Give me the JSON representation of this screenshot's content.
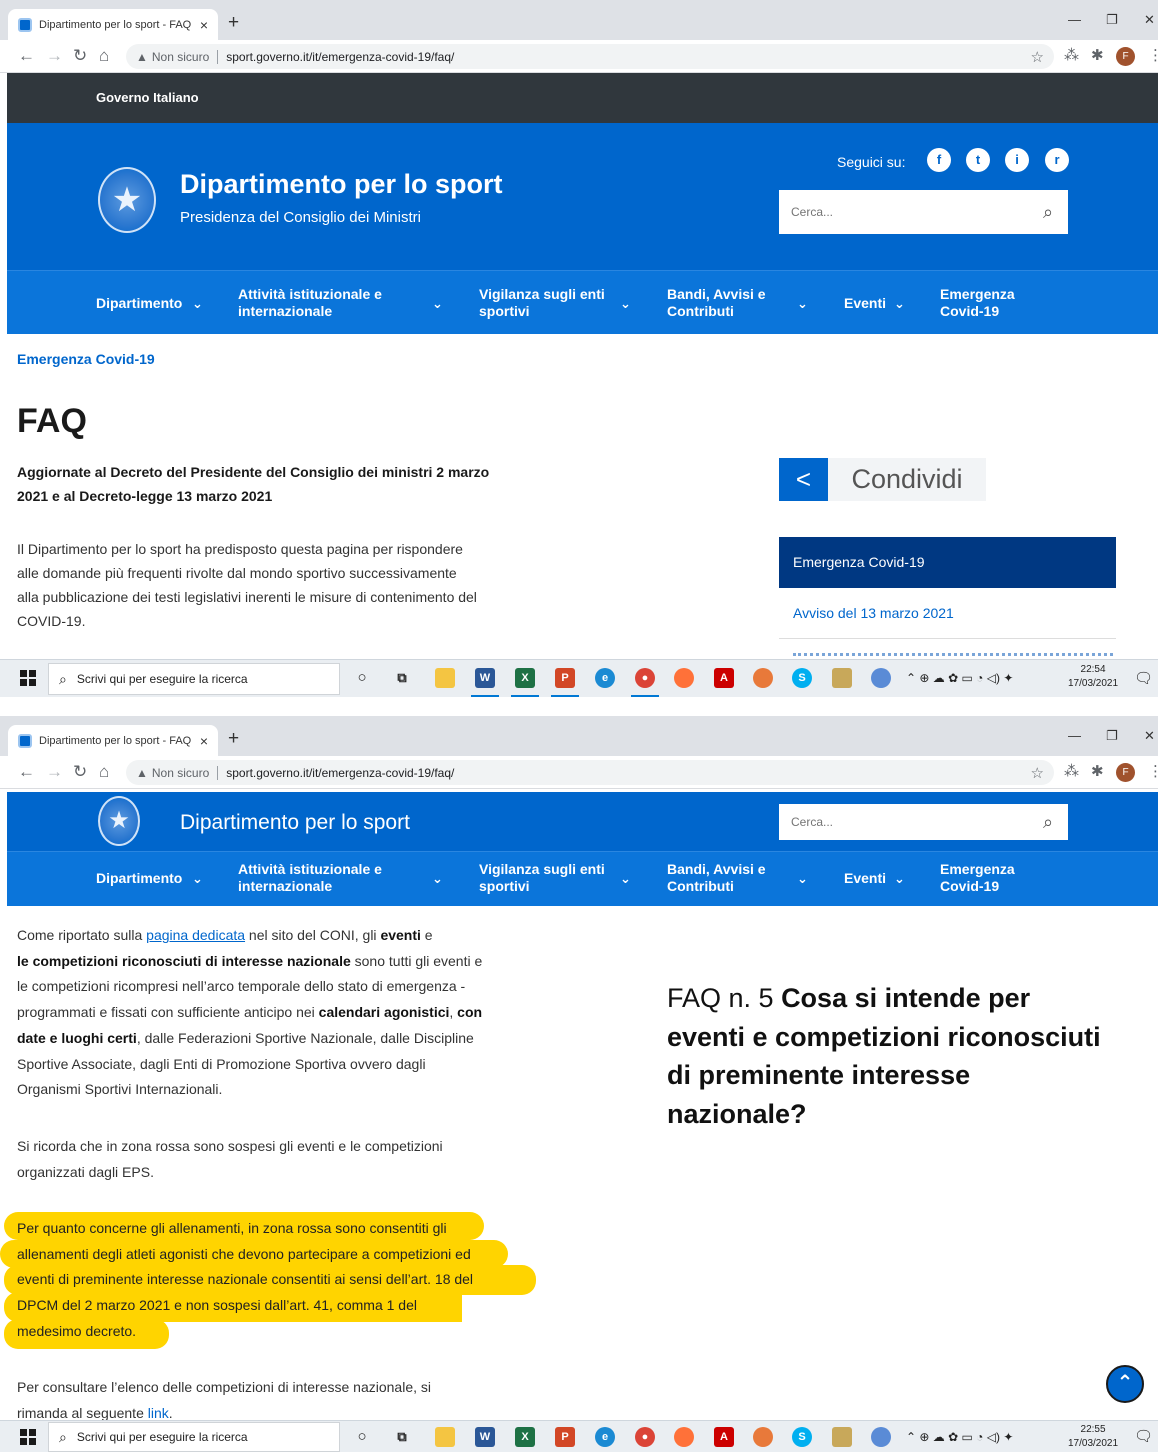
{
  "browser": {
    "tab_title": "Dipartimento per lo sport - FAQ",
    "tab_close": "×",
    "new_tab": "+",
    "insecure_label": "Non sicuro",
    "url": "sport.governo.it/it/emergenza-covid-19/faq/",
    "avatar_letter": "F"
  },
  "site": {
    "gov_bar": "Governo Italiano",
    "title": "Dipartimento per lo sport",
    "subtitle": "Presidenza del Consiglio dei Ministri",
    "follow_label": "Seguici su:",
    "social": [
      "f",
      "t",
      "i",
      "r"
    ],
    "search_placeholder": "Cerca...",
    "brand_color": "#0066cc"
  },
  "nav": {
    "items": [
      {
        "label": "Dipartimento"
      },
      {
        "label_1": "Attività istituzionale e",
        "label_2": "internazionale"
      },
      {
        "label_1": "Vigilanza sugli enti",
        "label_2": "sportivi"
      },
      {
        "label_1": "Bandi, Avvisi e",
        "label_2": "Contributi"
      },
      {
        "label": "Eventi"
      },
      {
        "label_1": "Emergenza",
        "label_2": "Covid-19"
      }
    ]
  },
  "page1": {
    "breadcrumb": "Emergenza Covid-19",
    "heading": "FAQ",
    "subtitle_1": "Aggiornate al Decreto del Presidente del Consiglio dei ministri 2 marzo",
    "subtitle_2": "2021 e al Decreto-legge 13 marzo 2021",
    "intro_1": "Il Dipartimento per lo sport ha predisposto questa pagina per rispondere",
    "intro_2": "alle domande più frequenti rivolte dal mondo sportivo successivamente",
    "intro_3": "alla pubblicazione dei testi legislativi inerenti le misure di contenimento del",
    "intro_4": "COVID-19.",
    "share_label": "Condividi",
    "sidebar_title": "Emergenza Covid-19",
    "sidebar_link": "Avviso del 13 marzo 2021"
  },
  "page2": {
    "p1": {
      "l1_a": "Come riportato sulla ",
      "l1_link": "pagina dedicata",
      "l1_b": " nel sito del CONI, gli ",
      "l1_bold": "eventi",
      "l1_c": " e",
      "l2_bold": "le competizioni riconosciuti di interesse nazionale",
      "l2_b": " sono tutti gli eventi e",
      "l3": "le competizioni ricompresi nell’arco temporale dello stato di emergenza -",
      "l4_a": "programmati e fissati con sufficiente anticipo nei ",
      "l4_bold": "calendari agonistici",
      "l4_b": ", ",
      "l4_bold2": "con",
      "l5_bold": "date e luoghi certi",
      "l5_b": ", dalle Federazioni Sportive Nazionale, dalle Discipline",
      "l6": "Sportive Associate, dagli Enti di Promozione Sportiva ovvero dagli",
      "l7": "Organismi Sportivi Internazionali."
    },
    "p2_1": "Si ricorda che in zona rossa sono sospesi gli eventi e le competizioni",
    "p2_2": "organizzati dagli EPS.",
    "p3_1": "Per quanto concerne gli allenamenti, in zona rossa sono consentiti gli",
    "p3_2": "allenamenti degli atleti agonisti che devono partecipare a competizioni ed",
    "p3_3": "eventi di preminente interesse nazionale consentiti ai sensi dell’art. 18 del",
    "p3_4": "DPCM del 2 marzo 2021 e non sospesi dall’art. 41, comma 1 del",
    "p3_5": "medesimo decreto.",
    "p4_1": "Per consultare l’elenco delle competizioni di interesse nazionale, si",
    "p4_2a": "rimanda al seguente ",
    "p4_link": "link",
    "faq_prefix": "FAQ n. 5 ",
    "faq_question": "Cosa si intende per eventi e competizioni riconosciuti di preminente interesse nazionale?",
    "highlight_color": "#ffd400"
  },
  "taskbar": {
    "search_placeholder": "Scrivi qui per eseguire la ricerca",
    "time_1": "22:54",
    "time_2": "22:55",
    "date": "17/03/2021"
  }
}
